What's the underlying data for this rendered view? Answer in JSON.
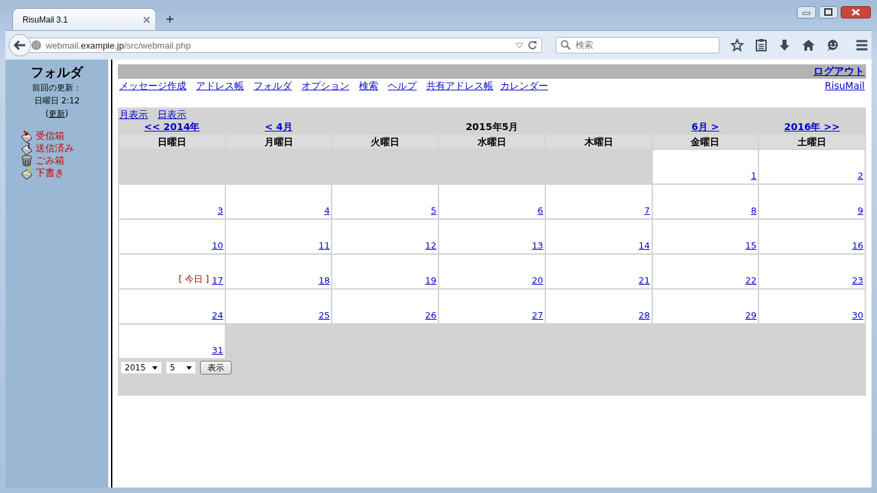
{
  "browser": {
    "tab_title": "RisuMail 3.1",
    "url": {
      "prefix": "webmail.",
      "host": "example.jp",
      "path": "/src/webmail.php"
    },
    "search_placeholder": "検索"
  },
  "sidebar": {
    "title": "フォルダ",
    "last_update_label": "前回の更新：",
    "last_update_time": "日曜日 2:12",
    "refresh_open": "(",
    "refresh_link": "更新",
    "refresh_close": ")",
    "folders": [
      {
        "name": "受信箱",
        "kind": "inbox"
      },
      {
        "name": "送信済み",
        "kind": "sent"
      },
      {
        "name": "ごみ箱",
        "kind": "trash"
      },
      {
        "name": "下書き",
        "kind": "drafts"
      }
    ]
  },
  "top_bar": {
    "logout": "ログアウト"
  },
  "menu": [
    "メッセージ作成",
    "アドレス帳",
    "フォルダ",
    "オプション",
    "検索",
    "ヘルプ",
    "共有アドレス帳",
    "カレンダー"
  ],
  "brand_link": "RisuMail",
  "view_links": [
    "月表示",
    "日表示"
  ],
  "calendar": {
    "prev_year": "<< 2014年",
    "prev_month": "< 4月",
    "title": "2015年5月",
    "next_month": "6月 >",
    "next_year": "2016年 >>",
    "weekdays": [
      "日曜日",
      "月曜日",
      "火曜日",
      "水曜日",
      "木曜日",
      "金曜日",
      "土曜日"
    ],
    "weeks": [
      [
        {
          "kind": "blank"
        },
        {
          "kind": "blank"
        },
        {
          "kind": "blank"
        },
        {
          "kind": "blank"
        },
        {
          "kind": "blank"
        },
        {
          "day": "1"
        },
        {
          "day": "2"
        }
      ],
      [
        {
          "day": "3"
        },
        {
          "day": "4"
        },
        {
          "day": "5"
        },
        {
          "day": "6"
        },
        {
          "day": "7"
        },
        {
          "day": "8"
        },
        {
          "day": "9"
        }
      ],
      [
        {
          "day": "10"
        },
        {
          "day": "11"
        },
        {
          "day": "12"
        },
        {
          "day": "13"
        },
        {
          "day": "14"
        },
        {
          "day": "15"
        },
        {
          "day": "16"
        }
      ],
      [
        {
          "day": "17",
          "note": "[ 今日 ]"
        },
        {
          "day": "18"
        },
        {
          "day": "19"
        },
        {
          "day": "20"
        },
        {
          "day": "21"
        },
        {
          "day": "22"
        },
        {
          "day": "23"
        }
      ],
      [
        {
          "day": "24"
        },
        {
          "day": "25"
        },
        {
          "day": "26"
        },
        {
          "day": "27"
        },
        {
          "day": "28"
        },
        {
          "day": "29"
        },
        {
          "day": "30"
        }
      ],
      [
        {
          "day": "31"
        },
        {
          "kind": "blank"
        },
        {
          "kind": "blank"
        },
        {
          "kind": "blank"
        },
        {
          "kind": "blank"
        },
        {
          "kind": "blank"
        },
        {
          "kind": "blank"
        }
      ]
    ],
    "year_select": "2015",
    "month_select": "5",
    "show_button": "表示"
  }
}
